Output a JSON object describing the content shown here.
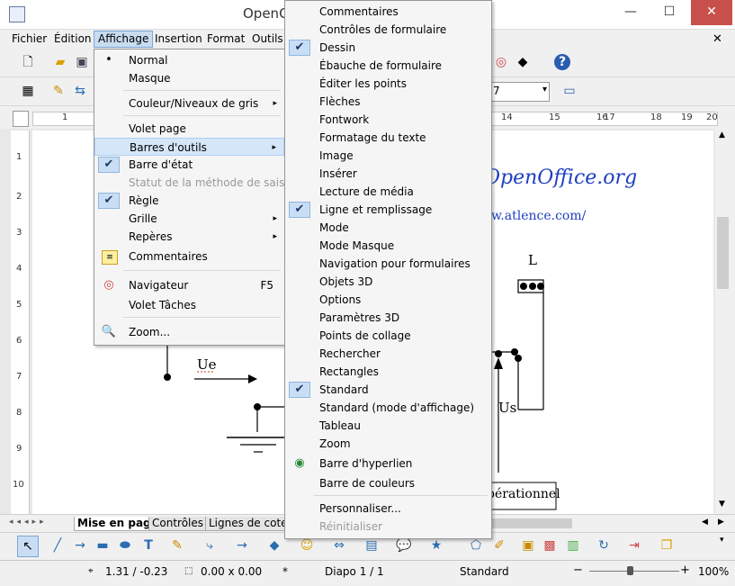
{
  "window": {
    "title": "OpenOffice.org Impress",
    "title_visible": "OpenO",
    "min": "—",
    "max": "☐",
    "close": "✕"
  },
  "menubar": {
    "items": [
      "Fichier",
      "Édition",
      "Affichage",
      "Insertion",
      "Format",
      "Outils"
    ],
    "close": "✕"
  },
  "ruler": {
    "ticks": [
      "1",
      "14",
      "15",
      "16",
      "17",
      "18",
      "19",
      "20"
    ]
  },
  "vruler": {
    "ticks": [
      "1",
      "2",
      "3",
      "4",
      "5",
      "6",
      "7",
      "8",
      "9",
      "10"
    ]
  },
  "drawing": {
    "heading": "OpenOffice.org",
    "url": "www.atlence.com/",
    "label_L": "L",
    "label_Ue": "Ue",
    "label_Us": "Us",
    "box_text": "pérationnel"
  },
  "toolbar2": {
    "zoom_field": "7"
  },
  "affichage_menu": {
    "items": [
      {
        "label": "Normal",
        "mark": "•"
      },
      {
        "label": "Masque"
      },
      {
        "label": "Couleur/Niveaux de gris",
        "submenu": true
      },
      {
        "label": "Volet page"
      },
      {
        "label": "Barres d'outils",
        "submenu": true,
        "highlighted": true
      },
      {
        "label": "Barre d'état",
        "checked": true
      },
      {
        "label": "Statut de la méthode de saisie",
        "disabled": true
      },
      {
        "label": "Règle",
        "checked": true
      },
      {
        "label": "Grille",
        "submenu": true
      },
      {
        "label": "Repères",
        "submenu": true
      },
      {
        "label": "Commentaires",
        "icon": "note-icon"
      },
      {
        "label": "Navigateur",
        "accel": "F5",
        "icon": "compass-icon"
      },
      {
        "label": "Volet Tâches"
      },
      {
        "label": "Zoom...",
        "icon": "magnifier-icon"
      }
    ]
  },
  "toolbars_submenu": {
    "items": [
      {
        "label": "Commentaires"
      },
      {
        "label": "Contrôles de formulaire"
      },
      {
        "label": "Dessin",
        "checked": true
      },
      {
        "label": "Ébauche de formulaire"
      },
      {
        "label": "Éditer les points"
      },
      {
        "label": "Flèches"
      },
      {
        "label": "Fontwork"
      },
      {
        "label": "Formatage du texte"
      },
      {
        "label": "Image"
      },
      {
        "label": "Insérer"
      },
      {
        "label": "Lecture de média"
      },
      {
        "label": "Ligne et remplissage",
        "checked": true
      },
      {
        "label": "Mode"
      },
      {
        "label": "Mode Masque"
      },
      {
        "label": "Navigation pour formulaires"
      },
      {
        "label": "Objets 3D"
      },
      {
        "label": "Options"
      },
      {
        "label": "Paramètres 3D"
      },
      {
        "label": "Points de collage"
      },
      {
        "label": "Rechercher"
      },
      {
        "label": "Rectangles"
      },
      {
        "label": "Standard",
        "checked": true
      },
      {
        "label": "Standard (mode d'affichage)"
      },
      {
        "label": "Tableau"
      },
      {
        "label": "Zoom"
      },
      {
        "label": "Barre d'hyperlien",
        "icon": "hyperlink-icon"
      },
      {
        "label": "Barre de couleurs"
      },
      {
        "label": "Personnaliser..."
      },
      {
        "label": "Réinitialiser",
        "disabled": true
      }
    ]
  },
  "tabs": [
    "Mise en page",
    "Contrôles",
    "Lignes de cote"
  ],
  "statusbar": {
    "position": "1.31 / -0.23",
    "size": "0.00 x 0.00",
    "modified": "*",
    "slide": "Diapo 1 / 1",
    "layout": "Standard",
    "zoom": "100%",
    "zoom_minus": "−",
    "zoom_plus": "+"
  },
  "colors": {
    "accent": "#c8dcf0",
    "check_bg": "#c9def5",
    "close_red": "#c7504b",
    "link_blue": "#1f3fbf"
  }
}
